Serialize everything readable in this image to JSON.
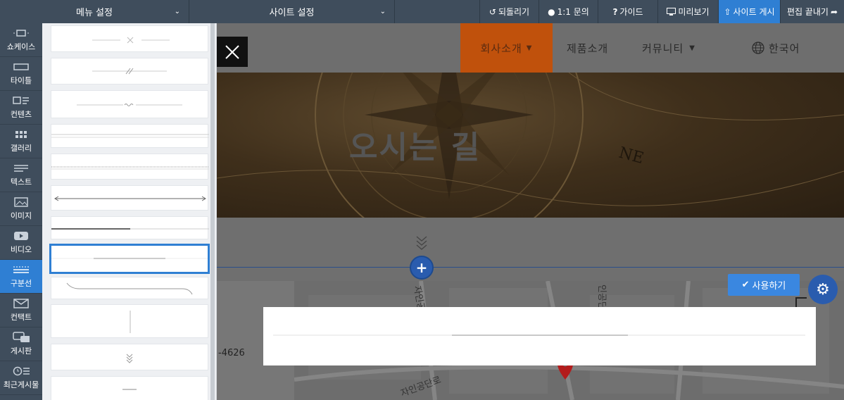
{
  "topbar": {
    "menu_settings": "메뉴 설정",
    "site_settings": "사이트 설정",
    "undo": "되돌리기",
    "inquiry": "1:1 문의",
    "guide": "가이드",
    "preview": "미리보기",
    "publish": "사이트 게시",
    "finish": "편집 끝내기"
  },
  "sidebar": {
    "items": [
      {
        "label": "쇼케이스",
        "icon": "showcase-icon"
      },
      {
        "label": "타이틀",
        "icon": "title-icon"
      },
      {
        "label": "컨텐츠",
        "icon": "contents-icon"
      },
      {
        "label": "갤러리",
        "icon": "gallery-icon"
      },
      {
        "label": "텍스트",
        "icon": "text-icon"
      },
      {
        "label": "이미지",
        "icon": "image-icon"
      },
      {
        "label": "비디오",
        "icon": "video-icon"
      },
      {
        "label": "구분선",
        "icon": "divider-icon",
        "active": true
      },
      {
        "label": "컨택트",
        "icon": "contact-icon"
      },
      {
        "label": "게시판",
        "icon": "board-icon"
      },
      {
        "label": "최근게시물",
        "icon": "recent-posts-icon"
      }
    ]
  },
  "site": {
    "nav": [
      "회사소개",
      "제품소개",
      "커뮤니티",
      "한국어"
    ],
    "hero_title": "오시는 길",
    "phone_fragment": "-4626",
    "map_labels": [
      "자인공단로",
      "인공단",
      "자인공단로"
    ]
  },
  "actions": {
    "use_button": "사용하기"
  },
  "colors": {
    "topbar": "#3f4d5c",
    "accent": "#2f7fd3",
    "nav_active": "#c0510c"
  }
}
